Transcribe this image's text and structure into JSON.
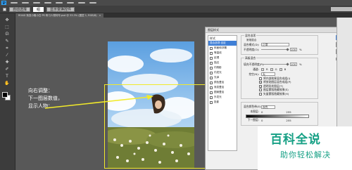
{
  "app": {
    "logo": "PS"
  },
  "options_bar": {
    "buttons": [
      {
        "label": "自动选择",
        "selected": false
      },
      {
        "label": "组",
        "selected": true
      },
      {
        "label": "显示变换控件",
        "selected": false
      }
    ]
  },
  "tabs": [
    {
      "label": "ROAD 渐变小格小白 PS 练习人物特写.psd @ 33.3% (图层 1, RGB/8)"
    }
  ],
  "annotation": {
    "line1": "向右调整：",
    "line2": "下一图层数值，",
    "line3": "显示人物："
  },
  "dialog": {
    "title": "图层样式",
    "buttons": {
      "ok": "确定",
      "cancel": "取消",
      "new_style": "新建样式(W)...",
      "preview": "预览(V)"
    },
    "left_items": [
      {
        "label": "样式",
        "checkbox": false,
        "active": false
      },
      {
        "label": "混合选项:自定",
        "checkbox": false,
        "active": true
      },
      {
        "label": "斜面和浮雕",
        "checkbox": true,
        "active": false
      },
      {
        "label": "等高线",
        "checkbox": true,
        "active": false
      },
      {
        "label": "纹理",
        "checkbox": true,
        "active": false
      },
      {
        "label": "描边",
        "checkbox": true,
        "active": false
      },
      {
        "label": "内阴影",
        "checkbox": true,
        "active": false
      },
      {
        "label": "内发光",
        "checkbox": true,
        "active": false
      },
      {
        "label": "光泽",
        "checkbox": true,
        "active": false
      },
      {
        "label": "颜色叠加",
        "checkbox": true,
        "active": false
      },
      {
        "label": "渐变叠加",
        "checkbox": true,
        "active": false
      },
      {
        "label": "图案叠加",
        "checkbox": true,
        "active": false
      },
      {
        "label": "外发光",
        "checkbox": true,
        "active": false
      },
      {
        "label": "投影",
        "checkbox": true,
        "active": false
      }
    ],
    "general_blending": {
      "legend": "混合选项",
      "sub_legend": "常规混合",
      "mode_label": "混合模式(D):",
      "mode_value": "正常",
      "opacity_label": "不透明度(O):",
      "opacity_value": "100",
      "opacity_unit": "%"
    },
    "advanced_blending": {
      "legend": "高级混合",
      "fill_label": "填充不透明度(F):",
      "fill_value": "100",
      "fill_unit": "%",
      "channels_label": "通道:",
      "channels": [
        "R",
        "G",
        "B"
      ],
      "knockout_label": "挖空(N):",
      "knockout_value": "无",
      "checks": [
        {
          "label": "将内部效果混合成组(I)",
          "on": false
        },
        {
          "label": "将剪贴图层混合成组(P)",
          "on": true
        },
        {
          "label": "透明形状图层(T)",
          "on": true
        },
        {
          "label": "图层蒙版隐藏效果(S)",
          "on": false
        },
        {
          "label": "矢量蒙版隐藏效果(H)",
          "on": false
        }
      ]
    },
    "blend_if": {
      "label": "混合颜色带(E):",
      "value": "灰色",
      "this_layer_label": "本图层:",
      "this_low": "0",
      "this_high": "255",
      "next_layer_label": "下一图层:",
      "next_low": "0",
      "next_high": "255"
    }
  },
  "watermark": {
    "title": "百科全说",
    "subtitle": "助你轻松解决"
  },
  "colors": {
    "annotation_yellow": "#f2ea2a",
    "watermark_green": "#16a085",
    "selection_blue": "#3f7fd6"
  }
}
